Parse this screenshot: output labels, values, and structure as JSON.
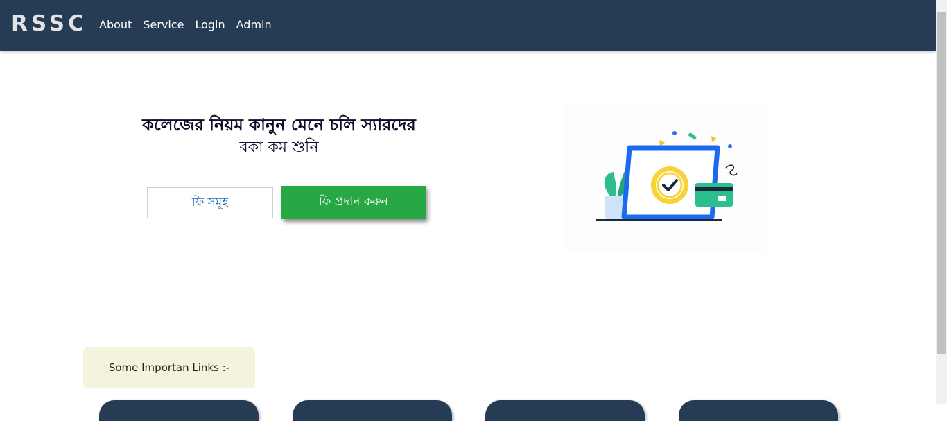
{
  "navbar": {
    "brand": "RSSC",
    "links": [
      "About",
      "Service",
      "Login",
      "Admin"
    ]
  },
  "hero": {
    "title": "কলেজের নিয়ম কানুন মেনে চলি স্যারদের",
    "subtitle": "বকা কম শুনি",
    "fees_button": "ফি সমূহ",
    "pay_button": "ফি প্রদান করুন"
  },
  "links_section": {
    "label": "Some Importan Links :-"
  },
  "colors": {
    "navbar": "#263b54",
    "pay_button": "#28a745",
    "fees_text": "#1a6fb8",
    "links_box": "#f4f3dc"
  },
  "icons": {
    "illustration": "laptop-payment-illustration"
  }
}
